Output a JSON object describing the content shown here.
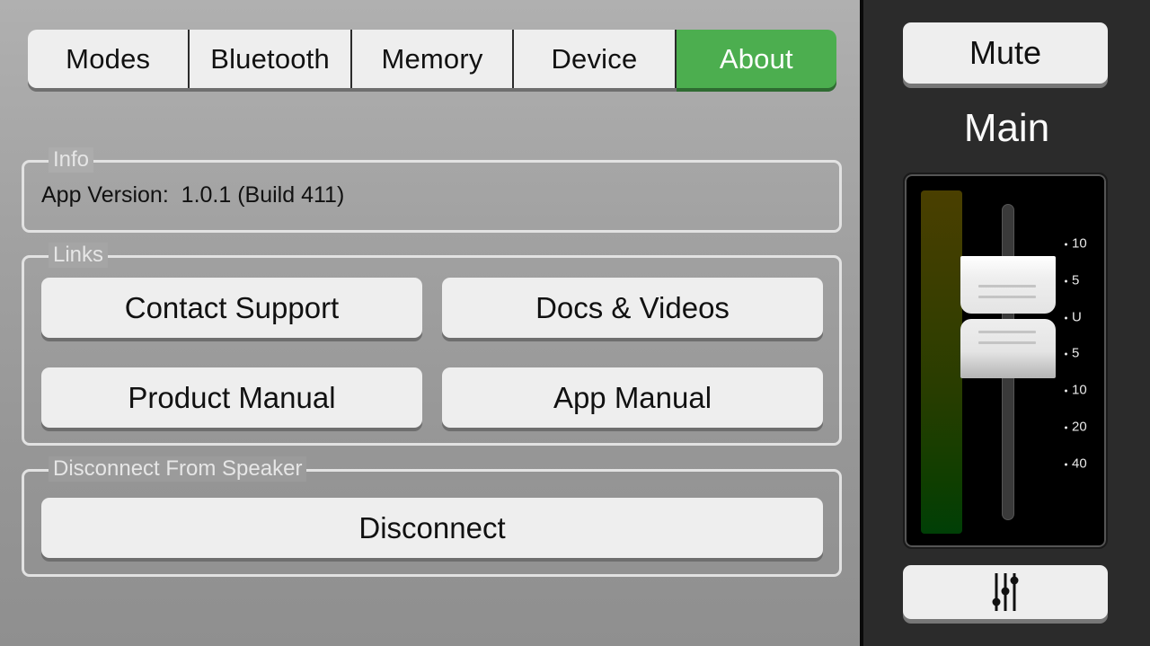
{
  "tabs": [
    {
      "label": "Modes",
      "active": false
    },
    {
      "label": "Bluetooth",
      "active": false
    },
    {
      "label": "Memory",
      "active": false
    },
    {
      "label": "Device",
      "active": false
    },
    {
      "label": "About",
      "active": true
    }
  ],
  "colors": {
    "active_tab": "#4cae4f",
    "button_bg": "#eeeeee",
    "sidebar_bg": "#2b2b2b"
  },
  "info": {
    "legend": "Info",
    "app_version_label": "App Version:",
    "app_version_value": "1.0.1 (Build 411)"
  },
  "links": {
    "legend": "Links",
    "buttons": [
      {
        "label": "Contact Support"
      },
      {
        "label": "Docs & Videos"
      },
      {
        "label": "Product Manual"
      },
      {
        "label": "App Manual"
      }
    ]
  },
  "disconnect": {
    "legend": "Disconnect From Speaker",
    "button_label": "Disconnect"
  },
  "sidebar": {
    "mute_label": "Mute",
    "channel_name": "Main",
    "fader": {
      "scale_marks": [
        "10",
        "5",
        "U",
        "5",
        "10",
        "20",
        "40"
      ],
      "level": "U"
    },
    "mixer_icon": "sliders-icon"
  }
}
